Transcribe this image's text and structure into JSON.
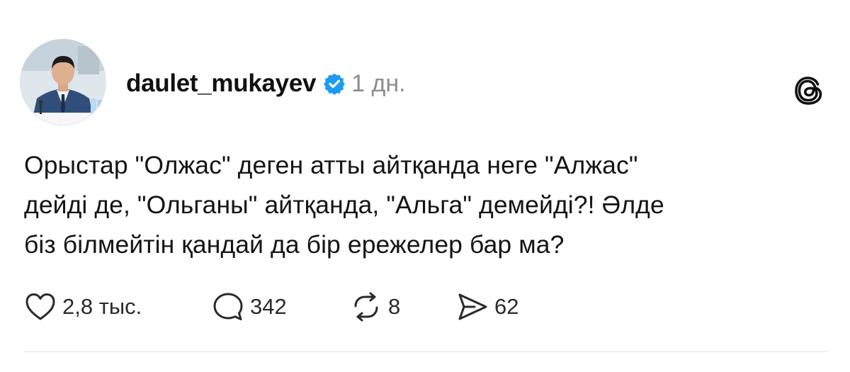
{
  "post": {
    "author": {
      "username": "daulet_mukayev",
      "verified": true,
      "avatar": "avatar-photo-icon"
    },
    "timestamp": "1 дн.",
    "app_logo": "threads-logo-icon",
    "text_lines": [
      "Орыстар \"Олжас\" деген атты айтқанда неге \"Алжас\"",
      "дейді де, \"Ольганы\" айтқанда, \"Альга\" демейді?! Әлде",
      "біз білмейтін қандай да бір ережелер бар ма?"
    ],
    "actions": {
      "likes": {
        "icon": "heart-icon",
        "count": "2,8 тыс."
      },
      "replies": {
        "icon": "comment-icon",
        "count": "342"
      },
      "reposts": {
        "icon": "repost-icon",
        "count": "8"
      },
      "shares": {
        "icon": "share-icon",
        "count": "62"
      }
    }
  },
  "colors": {
    "verified_badge": "#1d9bf0",
    "text": "#141414",
    "muted": "#8d8d8d",
    "divider": "#e3e3e3"
  }
}
